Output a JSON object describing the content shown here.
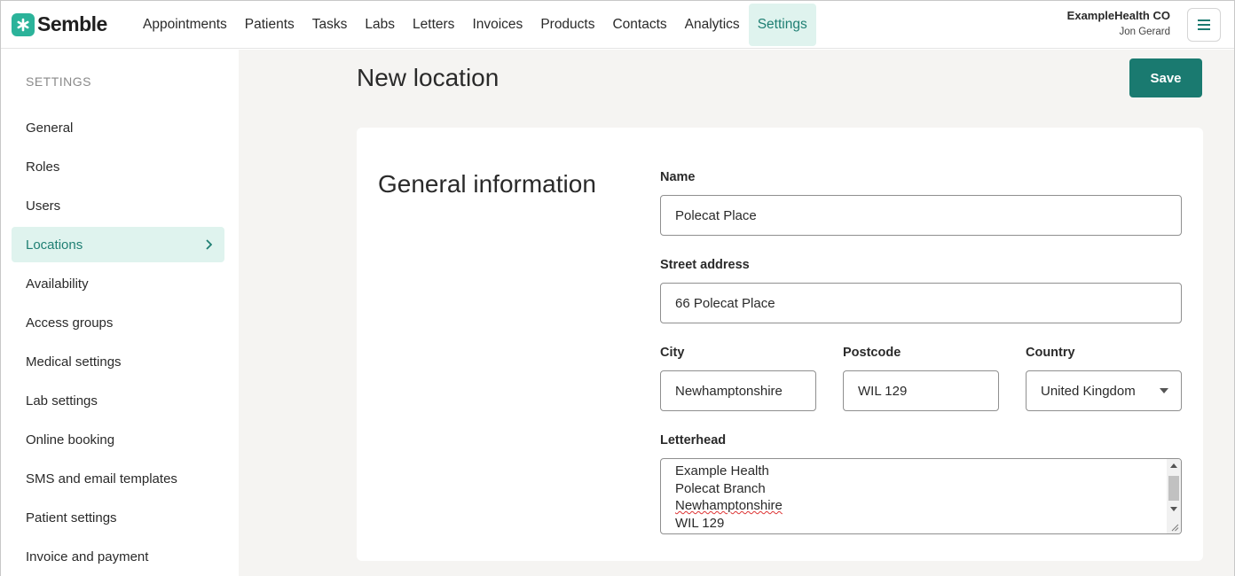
{
  "app": {
    "brand": "Semble",
    "accent": "#1a7a70",
    "accent_light": "#dff3ee"
  },
  "nav": {
    "items": [
      "Appointments",
      "Patients",
      "Tasks",
      "Labs",
      "Letters",
      "Invoices",
      "Products",
      "Contacts",
      "Analytics",
      "Settings"
    ],
    "active": "Settings"
  },
  "account": {
    "org": "ExampleHealth CO",
    "user": "Jon Gerard",
    "menu_icon": "hamburger-icon"
  },
  "sidebar": {
    "heading": "SETTINGS",
    "items": [
      {
        "label": "General"
      },
      {
        "label": "Roles"
      },
      {
        "label": "Users"
      },
      {
        "label": "Locations",
        "active": true,
        "icon": "chevron-right-icon"
      },
      {
        "label": "Availability"
      },
      {
        "label": "Access groups"
      },
      {
        "label": "Medical settings"
      },
      {
        "label": "Lab settings"
      },
      {
        "label": "Online booking"
      },
      {
        "label": "SMS and email templates"
      },
      {
        "label": "Patient settings"
      },
      {
        "label": "Invoice and payment"
      }
    ]
  },
  "page": {
    "title": "New location",
    "save_label": "Save"
  },
  "form": {
    "section_title": "General information",
    "name": {
      "label": "Name",
      "value": "Polecat Place"
    },
    "street": {
      "label": "Street address",
      "value": "66 Polecat Place"
    },
    "city": {
      "label": "City",
      "value": "Newhamptonshire"
    },
    "postcode": {
      "label": "Postcode",
      "value": "WIL 129"
    },
    "country": {
      "label": "Country",
      "value": "United Kingdom"
    },
    "letterhead": {
      "label": "Letterhead",
      "lines": [
        "Example Health",
        "Polecat Branch",
        "Newhamptonshire",
        "WIL 129"
      ]
    }
  }
}
